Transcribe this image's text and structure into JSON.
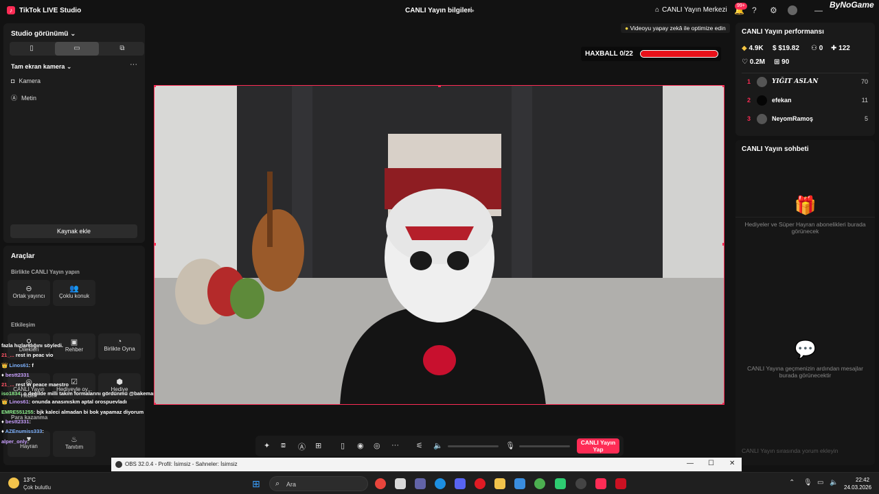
{
  "titlebar": {
    "app_title": "TikTok LIVE Studio",
    "live_info": "CANLI Yayın bilgileri",
    "live_center": "CANLI Yayın Merkezi",
    "notif_count": "99+",
    "brand": "ByNoGame"
  },
  "left_panel": {
    "studio_view": "Studio görünümü",
    "scene_title": "Tam ekran kamera",
    "sources": [
      "Kamera",
      "Metin"
    ],
    "add_source": "Kaynak ekle"
  },
  "tools": {
    "title": "Araçlar",
    "section_collab": "Birlikte CANLI Yayın yapın",
    "collab_items": [
      "Ortak yayıncı",
      "Çoklu konuk"
    ],
    "section_engage": "Etkileşim",
    "engage_items": [
      "Dilekleri",
      "Rehber",
      "Birlikte Oyna",
      "CANLI Yayın Hedefi",
      "Hediyeyle oy...",
      "Hediye"
    ],
    "section_earn": "Para kazanma",
    "earn_items": [
      "Hayran",
      "Tanıtım"
    ]
  },
  "chat_overlay": [
    {
      "user": "",
      "text": "fazla hızlandığını söyledi."
    },
    {
      "user": "21_...",
      "text": "rest in peac vio"
    },
    {
      "user": "Linos61",
      "text": "f"
    },
    {
      "user": "bestt2331",
      "text": ""
    },
    {
      "user": "21_...",
      "text": "rest in peace maestro"
    },
    {
      "user": "iso1834",
      "text": "o değilde milli takım formalarını gördünmü @bakemask"
    },
    {
      "user": "Linos61",
      "text": "onunda anasınıskm aptal orospuevladı"
    },
    {
      "user": "EMRE551255",
      "text": "bjk kaleci almadan bi bok yapamaz diyorum"
    },
    {
      "user": "bestt2331",
      "text": ""
    },
    {
      "user": "AZEnumiss333",
      "text": ""
    },
    {
      "user": "alper_only",
      "text": ""
    }
  ],
  "canvas": {
    "optimize_tip": "Videoyu yapay zekâ ile optimize edin",
    "haxball_label": "HAXBALL 0/22",
    "haxball_progress": 0
  },
  "bottom_toolbar": {
    "go_live": "CANLI Yayın Yap"
  },
  "performance": {
    "title": "CANLI Yayın performansı",
    "coins": "4.9K",
    "dollars": "$19.82",
    "viewers": "0",
    "followers": "122",
    "likes": "0.2M",
    "gifts": "90",
    "ranking": [
      {
        "rank": "1",
        "name": "YIĞIT ASLAN",
        "score": "70"
      },
      {
        "rank": "2",
        "name": "efekan",
        "score": "11"
      },
      {
        "rank": "3",
        "name": "NeyomRamoş",
        "score": "5"
      }
    ]
  },
  "chat_panel": {
    "title": "CANLI Yayın sohbeti",
    "gift_empty": "Hediyeler ve Süper Hayran abonelikleri burada görünecek",
    "msg_empty": "CANLI Yayına geçmenizin ardından mesajlar burada görünecektir",
    "input_placeholder": "CANLI Yayın sırasında yorum ekleyin"
  },
  "obs": {
    "title": "OBS 32.0.4 - Profil: İsimsiz - Sahneler: İsimsiz"
  },
  "taskbar": {
    "temp": "13°C",
    "weather": "Çok bulutlu",
    "search": "Ara",
    "time": "22:42",
    "date": "24.03.2026"
  },
  "colors": {
    "accent": "#fe2c55",
    "progress_red": "#e8111a"
  }
}
